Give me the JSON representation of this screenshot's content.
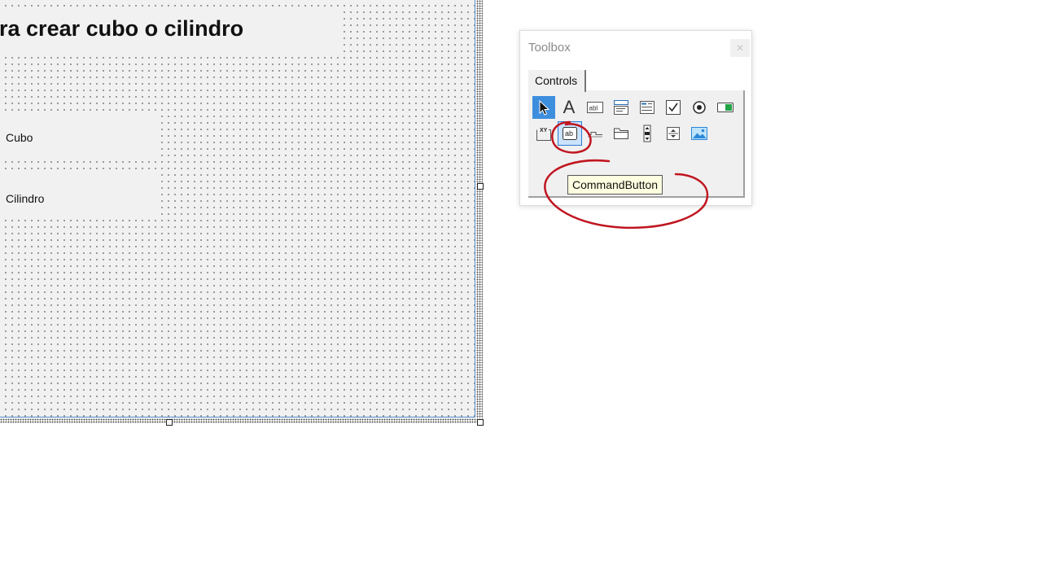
{
  "form": {
    "title": "ara crear cubo o cilindro",
    "options": [
      {
        "label": "Cubo"
      },
      {
        "label": "Cilindro"
      }
    ]
  },
  "toolbox": {
    "title": "Toolbox",
    "close_glyph": "✕",
    "tab_label": "Controls",
    "tools_row1": [
      {
        "name": "select-objects-icon"
      },
      {
        "name": "label-icon",
        "glyph": "A"
      },
      {
        "name": "textbox-icon",
        "glyph": "abl"
      },
      {
        "name": "combobox-icon"
      },
      {
        "name": "listbox-icon"
      },
      {
        "name": "checkbox-icon",
        "glyph": "✓"
      },
      {
        "name": "optionbutton-icon"
      },
      {
        "name": "togglebutton-icon"
      }
    ],
    "tools_row2": [
      {
        "name": "frame-icon",
        "glyph": "XY"
      },
      {
        "name": "commandbutton-icon",
        "glyph": "ab"
      },
      {
        "name": "tabstrip-icon"
      },
      {
        "name": "multipage-icon"
      },
      {
        "name": "scrollbar-icon"
      },
      {
        "name": "spinbutton-icon"
      },
      {
        "name": "image-icon"
      }
    ],
    "tooltip": "CommandButton"
  },
  "colors": {
    "selected_tool": "#3e8ede",
    "annotation": "#c0151f",
    "tooltip_bg": "#ffffe1",
    "toggle_green": "#22a447"
  }
}
